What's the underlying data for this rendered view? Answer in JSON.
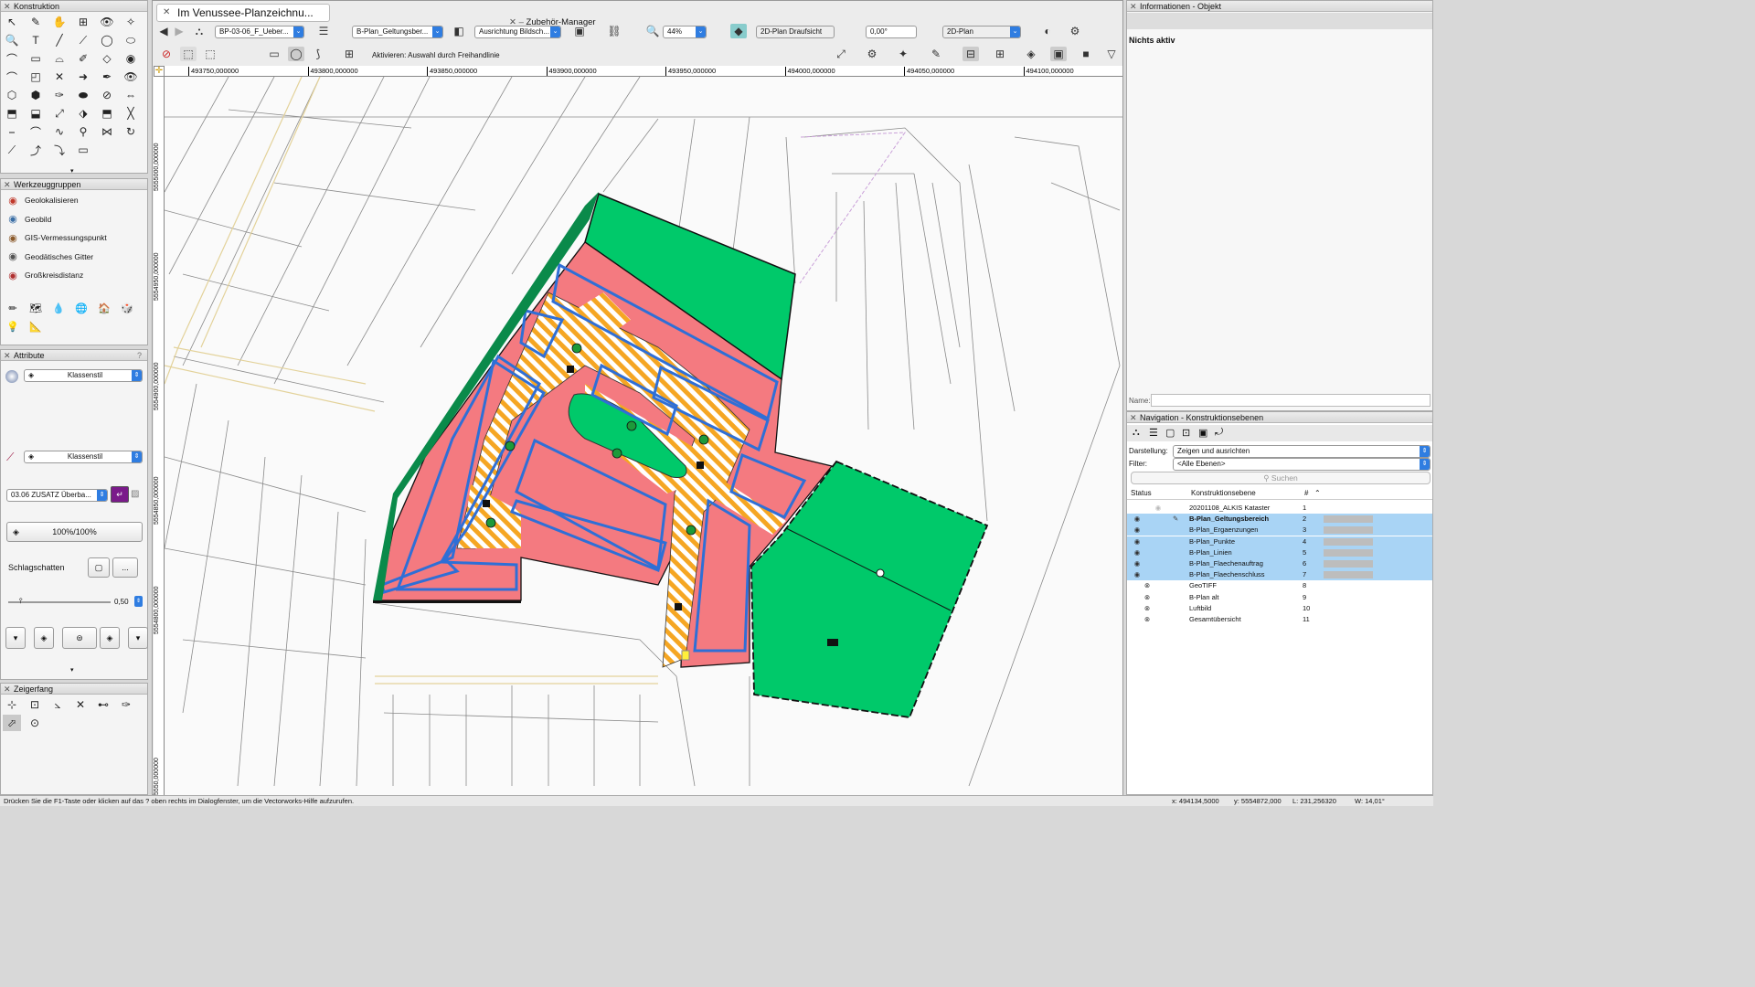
{
  "konstruktion": {
    "title": "Konstruktion"
  },
  "werkzeuggruppen": {
    "title": "Werkzeuggruppen",
    "items": [
      {
        "label": "Geolokalisieren",
        "icon": "geolocate-icon"
      },
      {
        "label": "Geobild",
        "icon": "geoimage-icon"
      },
      {
        "label": "GIS-Vermessungspunkt",
        "icon": "survey-point-icon"
      },
      {
        "label": "Geodätisches Gitter",
        "icon": "geodetic-grid-icon"
      },
      {
        "label": "Großkreisdistanz",
        "icon": "great-circle-icon"
      }
    ]
  },
  "attribute": {
    "title": "Attribute",
    "fill_style": "Klassenstil",
    "pen_style": "Klassenstil",
    "line_type": "03.06 ZUSATZ Überba...",
    "opacity": "100%/100%",
    "shadow_label": "Schlagschatten",
    "shadow_more": "...",
    "thickness": "0,50"
  },
  "zeigerfang": {
    "title": "Zeigerfang"
  },
  "document": {
    "tab_title": "Im Venussee-Planzeichnu...",
    "manager_title": "Zubehör-Manager"
  },
  "toolbar": {
    "sheet": "BP-03-06_F_Ueber...",
    "layer": "B-Plan_Geltungsber...",
    "view": "Ausrichtung Bildsch...",
    "zoom": "44%",
    "projection": "2D-Plan Draufsicht",
    "rotation": "0,00°",
    "render": "2D-Plan",
    "mode_hint": "Aktivieren: Auswahl durch Freihandlinie"
  },
  "ruler": {
    "x_labels": [
      "493750,000000",
      "493800,000000",
      "493850,000000",
      "493900,000000",
      "493950,000000",
      "494000,000000",
      "494050,000000",
      "494100,000000"
    ],
    "y_labels": [
      "5555000,000000",
      "5554950,000000",
      "5554900,000000",
      "5554850,000000",
      "5554800,000000",
      "5550,000000"
    ]
  },
  "info": {
    "title": "Informationen - Objekt",
    "status": "Nichts aktiv",
    "name_label": "Name:"
  },
  "navigation": {
    "title": "Navigation - Konstruktionsebenen",
    "darstellung_label": "Darstellung:",
    "darstellung_value": "Zeigen und ausrichten",
    "filter_label": "Filter:",
    "filter_value": "<Alle Ebenen>",
    "search_placeholder": "Suchen",
    "col_status": "Status",
    "col_layer": "Konstruktionsebene",
    "col_num": "#",
    "layers": [
      {
        "name": "20201108_ALKIS Kataster",
        "num": "1",
        "hl": false,
        "bold": false,
        "vis": "faded"
      },
      {
        "name": "B-Plan_Geltungsbereich",
        "num": "2",
        "hl": true,
        "bold": true,
        "vis": "on"
      },
      {
        "name": "B-Plan_Ergaenzungen",
        "num": "3",
        "hl": true,
        "bold": false,
        "vis": "on"
      },
      {
        "name": "B-Plan_Punkte",
        "num": "4",
        "hl": true,
        "bold": false,
        "vis": "on"
      },
      {
        "name": "B-Plan_Linien",
        "num": "5",
        "hl": true,
        "bold": false,
        "vis": "on"
      },
      {
        "name": "B-Plan_Flaechenauftrag",
        "num": "6",
        "hl": true,
        "bold": false,
        "vis": "on"
      },
      {
        "name": "B-Plan_Flaechenschluss",
        "num": "7",
        "hl": true,
        "bold": false,
        "vis": "on"
      },
      {
        "name": "GeoTIFF",
        "num": "8",
        "hl": false,
        "bold": false,
        "vis": "off"
      },
      {
        "name": "B-Plan alt",
        "num": "9",
        "hl": false,
        "bold": false,
        "vis": "off"
      },
      {
        "name": "Luftbild",
        "num": "10",
        "hl": false,
        "bold": false,
        "vis": "off"
      },
      {
        "name": "Gesamtübersicht",
        "num": "11",
        "hl": false,
        "bold": false,
        "vis": "off"
      }
    ]
  },
  "statusbar": {
    "help": "Drücken Sie die F1-Taste oder klicken auf das ? oben rechts im Dialogfenster, um die Vectorworks-Hilfe aufzurufen.",
    "x": "x: 494134,5000",
    "y": "y: 5554872,000",
    "l": "L: 231,256320",
    "w": "W: 14,01°"
  },
  "colors": {
    "green": "#00c96a",
    "pink": "#f47a80",
    "orange": "#f5a623",
    "blue": "#2f6fd6",
    "selection": "#a9d4f5"
  }
}
